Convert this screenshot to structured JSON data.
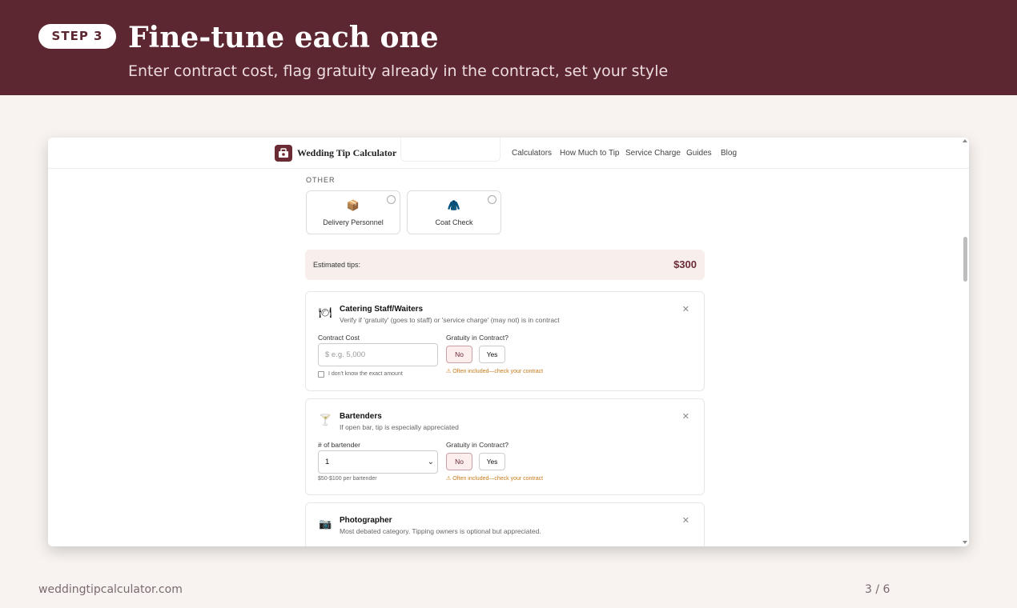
{
  "banner": {
    "step": "STEP 3",
    "title": "Fine-tune each one",
    "subtitle": "Enter contract cost, flag gratuity already in the contract, set your style"
  },
  "nav": {
    "brand": "Wedding Tip Calculator",
    "links": [
      "Calculators",
      "How Much to Tip",
      "Service Charge",
      "Guides",
      "Blog"
    ]
  },
  "other": {
    "label": "OTHER",
    "options": [
      {
        "label": "Delivery Personnel",
        "icon": "package-icon"
      },
      {
        "label": "Coat Check",
        "icon": "coat-icon"
      }
    ]
  },
  "estimate": {
    "label": "Estimated tips:",
    "value": "$300"
  },
  "vendors": [
    {
      "name": "Catering Staff/Waiters",
      "desc": "Verify if 'gratuity' (goes to staff) or 'service charge' (may not) is in contract",
      "icon": "plate-icon",
      "field_label": "Contract Cost",
      "input_placeholder": "$  e.g. 5,000",
      "gratuity_label": "Gratuity in Contract?",
      "no": "No",
      "yes": "Yes",
      "warning": "Often included—check your contract",
      "checkbox_label": "I don't know the exact amount"
    },
    {
      "name": "Bartenders",
      "desc": "If open bar, tip is especially appreciated",
      "icon": "cocktail-icon",
      "field_label": "# of bartender",
      "select_value": "1",
      "gratuity_label": "Gratuity in Contract?",
      "no": "No",
      "yes": "Yes",
      "warning": "Often included—check your contract",
      "hint": "$50-$100 per bartender"
    },
    {
      "name": "Photographer",
      "desc": "Most debated category. Tipping owners is optional but appreciated.",
      "icon": "camera-icon"
    }
  ],
  "footer": {
    "site": "weddingtipcalculator.com",
    "page": "3 / 6"
  },
  "colors": {
    "brand": "#5c2731",
    "accent": "#6b2b35",
    "warning": "#c77a1a"
  }
}
